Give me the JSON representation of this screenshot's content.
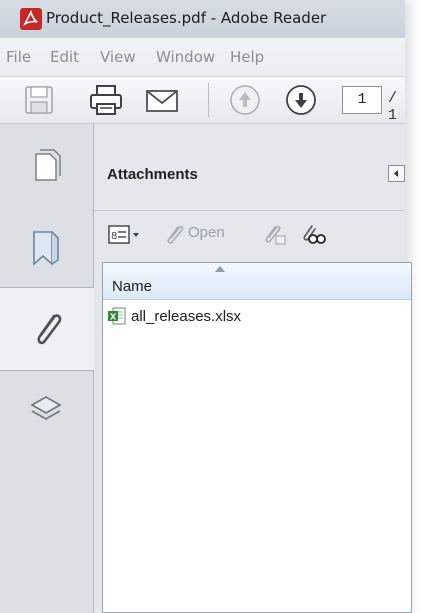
{
  "window": {
    "title": "Product_Releases.pdf - Adobe Reader",
    "icon": "adobe-pdf-icon"
  },
  "menubar": {
    "items": [
      "File",
      "Edit",
      "View",
      "Window",
      "Help"
    ]
  },
  "toolbar": {
    "icons": [
      "save-icon",
      "print-icon",
      "email-icon",
      "previous-page-icon",
      "next-page-icon"
    ],
    "current_page": "1",
    "page_total": "/ 1"
  },
  "nav_panel": {
    "buttons": [
      "page-thumbnails-icon",
      "bookmarks-icon",
      "attachments-icon",
      "layers-icon"
    ],
    "active": "attachments"
  },
  "attachments_panel": {
    "title": "Attachments",
    "toolbar": {
      "options_icon": "options-menu-icon",
      "open_label": "Open",
      "save_icon": "save-attachment-icon",
      "search_icon": "search-attachment-icon"
    },
    "list": {
      "column_header": "Name",
      "files": [
        {
          "name": "all_releases.xlsx",
          "icon": "excel-file-icon"
        }
      ]
    }
  },
  "colors": {
    "title_bar": "#c9d1db",
    "panel_bg": "#e4e7eb",
    "list_header": "#dbeaf7",
    "pdf_red": "#c62828",
    "excel_green": "#2e8b3a"
  }
}
